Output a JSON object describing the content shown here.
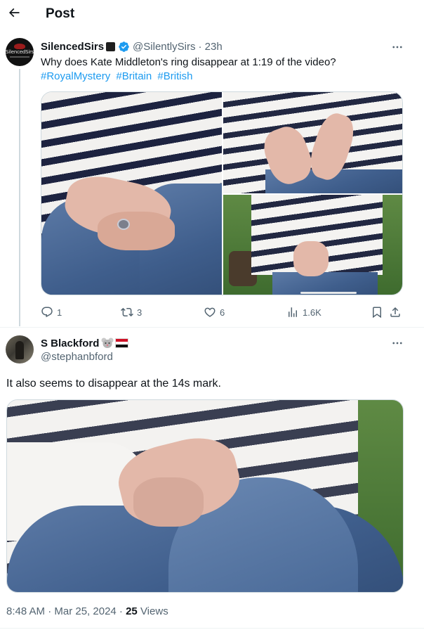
{
  "header": {
    "title": "Post"
  },
  "tweet1": {
    "name": "SilencedSirs",
    "handle": "@SilentlySirs",
    "time": "· 23h",
    "text": "Why does Kate Middleton's ring disappear at 1:19 of the video?",
    "hashtags": [
      "#RoyalMystery",
      "#Britain",
      "#British"
    ],
    "avatar_text": "SilencedSirs",
    "actions": {
      "replies": "1",
      "reposts": "3",
      "likes": "6",
      "views": "1.6K"
    }
  },
  "tweet2": {
    "name": "S Blackford",
    "handle": "@stephanbford",
    "text": "It also seems to disappear at the 14s mark.",
    "timestamp": "8:48 AM · Mar 25, 2024 · ",
    "views_count": "25",
    "views_label": " Views"
  },
  "colors": {
    "accent": "#1d9bf0",
    "muted": "#536471",
    "text": "#0f1419"
  },
  "icons": [
    "back-arrow-icon",
    "verified-badge-icon",
    "more-icon",
    "reply-icon",
    "retweet-icon",
    "like-icon",
    "views-icon",
    "bookmark-icon",
    "share-icon",
    "mouse-emoji-icon",
    "egypt-flag-icon"
  ]
}
